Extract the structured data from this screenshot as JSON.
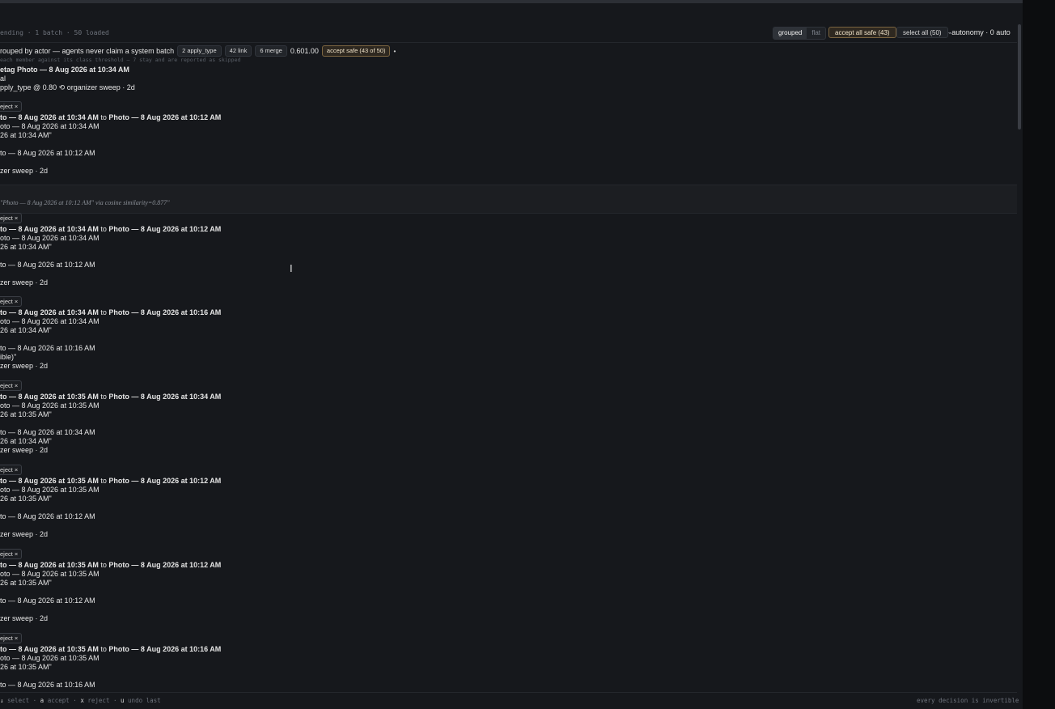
{
  "header": {
    "status": "ending · 1 batch · 50 loaded",
    "view_grouped": "grouped",
    "view_flat": "flat",
    "accept_all_safe": "accept all safe (43)",
    "select_all": "select all (50)",
    "autonomy": "autonomy · 0 auto"
  },
  "group": {
    "title": "rouped by actor — agents never claim a system batch",
    "pills": [
      "2 apply_type",
      "42 link",
      "6 merge"
    ],
    "range": "0.601.00",
    "accept_safe": "accept safe (43 of 50)",
    "dot": "•",
    "hint": "each member against its class threshold — 7 stay and are reported as skipped"
  },
  "first_item": {
    "retag_prefix": "etag",
    "retag_target": "Photo — 8 Aug 2026 at 10:34 AM",
    "type_text": "al",
    "meta": "pply_type @ 0.80 ⟲ organizer sweep · 2d"
  },
  "similar_note": "\"Photo — 8 Aug 2026 at 10:12 AM\" via cosine similarity=0.877\"",
  "cards": [
    {
      "reject": "eject ×",
      "from": "to — 8 Aug 2026 at 10:34 AM",
      "to_word": "to",
      "to": "Photo — 8 Aug 2026 at 10:12 AM",
      "src": "oto — 8 Aug 2026 at 10:34 AM",
      "quote": "26 at 10:34 AM\"",
      "target": "to — 8 Aug 2026 at 10:12 AM",
      "extra": "",
      "sweep": "zer sweep · 2d"
    },
    {
      "reject": "eject ×",
      "from": "to — 8 Aug 2026 at 10:34 AM",
      "to_word": "to",
      "to": "Photo — 8 Aug 2026 at 10:12 AM",
      "src": "oto — 8 Aug 2026 at 10:34 AM",
      "quote": "26 at 10:34 AM\"",
      "target": "to — 8 Aug 2026 at 10:12 AM",
      "extra": "",
      "sweep": "zer sweep · 2d"
    },
    {
      "reject": "eject ×",
      "from": "to — 8 Aug 2026 at 10:34 AM",
      "to_word": "to",
      "to": "Photo — 8 Aug 2026 at 10:16 AM",
      "src": "oto — 8 Aug 2026 at 10:34 AM",
      "quote": "26 at 10:34 AM\"",
      "target": "to — 8 Aug 2026 at 10:16 AM",
      "extra": "ible)\"",
      "sweep": "zer sweep · 2d"
    },
    {
      "reject": "eject ×",
      "from": "to — 8 Aug 2026 at 10:35 AM",
      "to_word": "to",
      "to": "Photo — 8 Aug 2026 at 10:34 AM",
      "src": "oto — 8 Aug 2026 at 10:35 AM",
      "quote": "26 at 10:35 AM\"",
      "target": "to — 8 Aug 2026 at 10:34 AM",
      "extra": "26 at 10:34 AM\"",
      "sweep": "zer sweep · 2d"
    },
    {
      "reject": "eject ×",
      "from": "to — 8 Aug 2026 at 10:35 AM",
      "to_word": "to",
      "to": "Photo — 8 Aug 2026 at 10:12 AM",
      "src": "oto — 8 Aug 2026 at 10:35 AM",
      "quote": "26 at 10:35 AM\"",
      "target": "to — 8 Aug 2026 at 10:12 AM",
      "extra": "",
      "sweep": "zer sweep · 2d"
    },
    {
      "reject": "eject ×",
      "from": "to — 8 Aug 2026 at 10:35 AM",
      "to_word": "to",
      "to": "Photo — 8 Aug 2026 at 10:12 AM",
      "src": "oto — 8 Aug 2026 at 10:35 AM",
      "quote": "26 at 10:35 AM\"",
      "target": "to — 8 Aug 2026 at 10:12 AM",
      "extra": "",
      "sweep": "zer sweep · 2d"
    },
    {
      "reject": "eject ×",
      "from": "to — 8 Aug 2026 at 10:35 AM",
      "to_word": "to",
      "to": "Photo — 8 Aug 2026 at 10:16 AM",
      "src": "oto — 8 Aug 2026 at 10:35 AM",
      "quote": "26 at 10:35 AM\"",
      "target": "to — 8 Aug 2026 at 10:16 AM",
      "extra": "",
      "sweep": ""
    }
  ],
  "footer": {
    "k_select": "↓",
    "select": "select ·",
    "k_accept": "a",
    "accept": "accept ·",
    "k_reject": "x",
    "reject": "reject ·",
    "k_undo": "u",
    "undo": "undo last",
    "right": "every decision is invertible"
  }
}
